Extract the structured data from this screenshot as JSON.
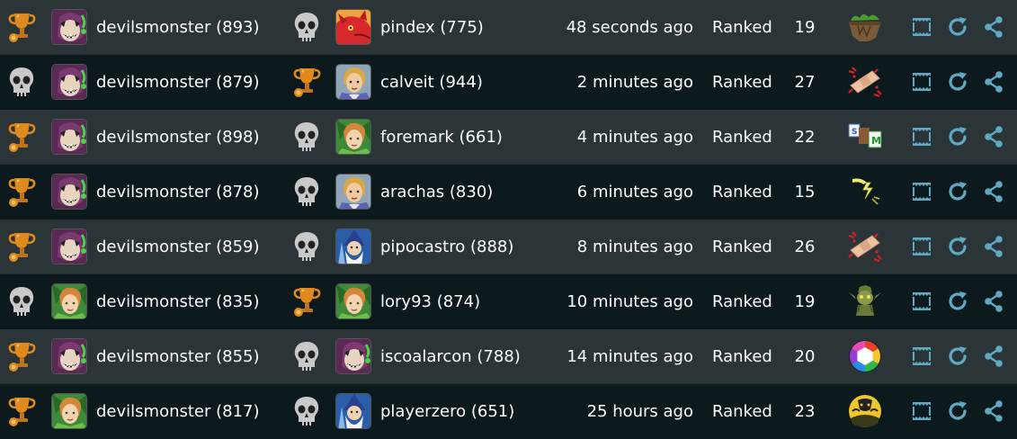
{
  "colors": {
    "row_even": "#2b3538",
    "row_odd": "#0d1a1d",
    "text": "#ffffff",
    "action_icon": "#5fa9c3",
    "trophy": "#e08a1e",
    "skull": "#c9c9c9"
  },
  "games": [
    {
      "p1": {
        "result": "trophy-icon",
        "avatar": "avatar-demon",
        "name": "devilsmonster (893)"
      },
      "p2": {
        "result": "skull-icon",
        "avatar": "avatar-dragon",
        "name": "pindex (775)"
      },
      "time": "48 seconds ago",
      "mode": "Ranked",
      "moves": "19",
      "game_icon": "island-game-icon"
    },
    {
      "p1": {
        "result": "skull-icon",
        "avatar": "avatar-demon",
        "name": "devilsmonster (879)"
      },
      "p2": {
        "result": "trophy-icon",
        "avatar": "avatar-knight",
        "name": "calveit (944)"
      },
      "time": "2 minutes ago",
      "mode": "Ranked",
      "moves": "27",
      "game_icon": "bandage-game-icon"
    },
    {
      "p1": {
        "result": "trophy-icon",
        "avatar": "avatar-demon",
        "name": "devilsmonster (898)"
      },
      "p2": {
        "result": "skull-icon",
        "avatar": "avatar-elf",
        "name": "foremark (661)"
      },
      "time": "4 minutes ago",
      "mode": "Ranked",
      "moves": "22",
      "game_icon": "letter-tiles-game-icon"
    },
    {
      "p1": {
        "result": "trophy-icon",
        "avatar": "avatar-demon",
        "name": "devilsmonster (878)"
      },
      "p2": {
        "result": "skull-icon",
        "avatar": "avatar-knight",
        "name": "arachas (830)"
      },
      "time": "6 minutes ago",
      "mode": "Ranked",
      "moves": "15",
      "game_icon": "lightning-game-icon"
    },
    {
      "p1": {
        "result": "trophy-icon",
        "avatar": "avatar-demon",
        "name": "devilsmonster (859)"
      },
      "p2": {
        "result": "skull-icon",
        "avatar": "avatar-wizard",
        "name": "pipocastro (888)"
      },
      "time": "8 minutes ago",
      "mode": "Ranked",
      "moves": "26",
      "game_icon": "bandage-game-icon"
    },
    {
      "p1": {
        "result": "skull-icon",
        "avatar": "avatar-elf",
        "name": "devilsmonster (835)"
      },
      "p2": {
        "result": "trophy-icon",
        "avatar": "avatar-elf",
        "name": "lory93 (874)"
      },
      "time": "10 minutes ago",
      "mode": "Ranked",
      "moves": "19",
      "game_icon": "goblin-game-icon"
    },
    {
      "p1": {
        "result": "trophy-icon",
        "avatar": "avatar-demon",
        "name": "devilsmonster (855)"
      },
      "p2": {
        "result": "skull-icon",
        "avatar": "avatar-demon",
        "name": "iscoalarcon (788)"
      },
      "time": "14 minutes ago",
      "mode": "Ranked",
      "moves": "20",
      "game_icon": "color-wheel-game-icon"
    },
    {
      "p1": {
        "result": "trophy-icon",
        "avatar": "avatar-elf",
        "name": "devilsmonster (817)"
      },
      "p2": {
        "result": "skull-icon",
        "avatar": "avatar-wizard",
        "name": "playerzero (651)"
      },
      "time": "25 hours ago",
      "mode": "Ranked",
      "moves": "23",
      "game_icon": "halloween-game-icon"
    }
  ],
  "actions": [
    {
      "name": "review-board-icon"
    },
    {
      "name": "rematch-icon"
    },
    {
      "name": "share-icon"
    }
  ]
}
